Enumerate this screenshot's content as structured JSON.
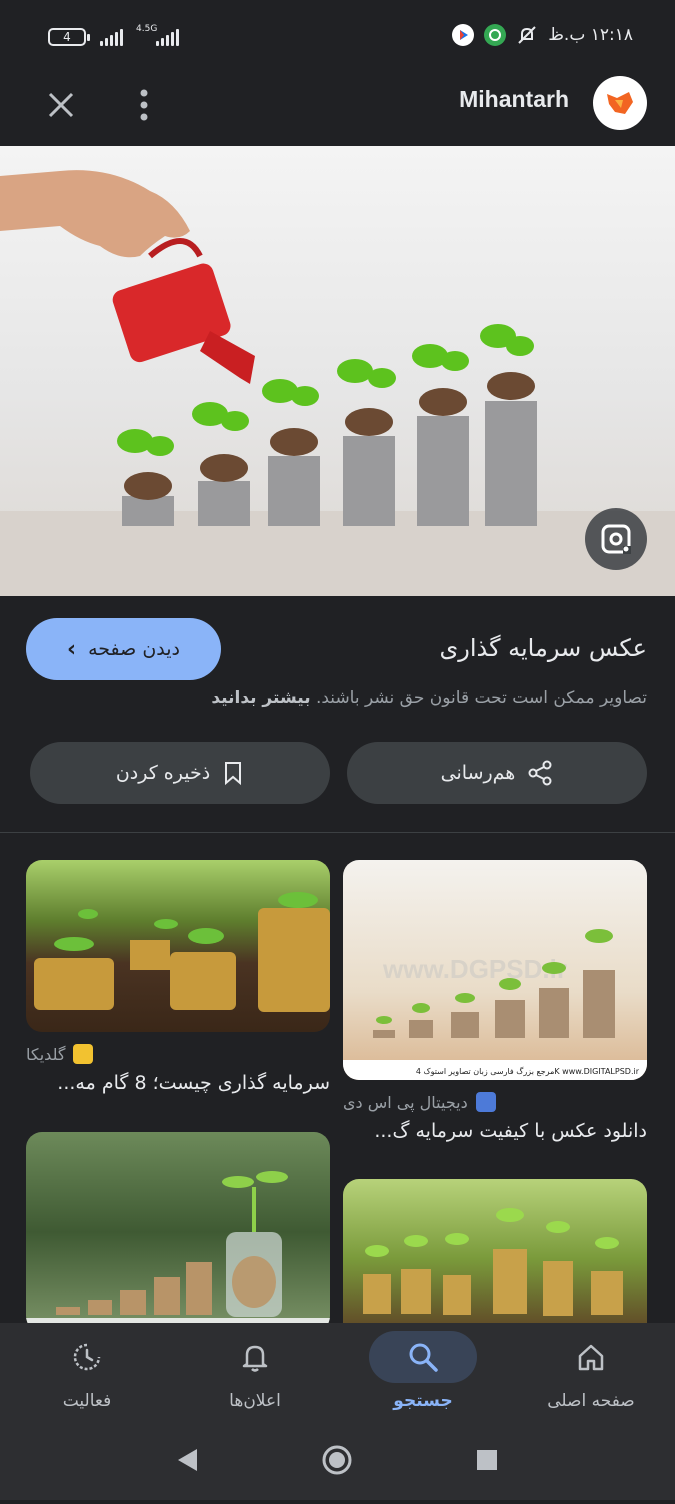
{
  "status_bar": {
    "battery": "4",
    "network": "4.5G",
    "time": "۱۲:۱۸ ب.ظ"
  },
  "header": {
    "site_name": "Mihantarh"
  },
  "image_info": {
    "visit_label": "دیدن صفحه",
    "title": "عکس سرمایه گذاری",
    "copyright_text": "تصاویر ممکن است تحت قانون حق نشر باشند.",
    "learn_more": "بیشتر بدانید",
    "share_label": "هم‌رسانی",
    "save_label": "ذخیره کردن"
  },
  "results": [
    {
      "source": "دیجیتال پی اس دی",
      "title": "دانلود عکس با کیفیت سرمایه گ...",
      "watermark": "www.DGPSD.ir",
      "caption_strip": "مرجع بزرگ فارسی زبان تصاویر استوک 4K  www.DIGITALPSD.ir"
    },
    {
      "source": "گلدیکا",
      "title": "سرمایه گذاری چیست؛ 8 گام مه..."
    }
  ],
  "bottom_nav": [
    {
      "label": "صفحه اصلی",
      "icon": "home-icon"
    },
    {
      "label": "جستجو",
      "icon": "search-icon",
      "active": true
    },
    {
      "label": "اعلان‌ها",
      "icon": "bell-icon"
    },
    {
      "label": "فعالیت",
      "icon": "activity-icon"
    }
  ],
  "colors": {
    "accent": "#8ab4f8",
    "background": "#202124",
    "surface": "#3c4043"
  }
}
